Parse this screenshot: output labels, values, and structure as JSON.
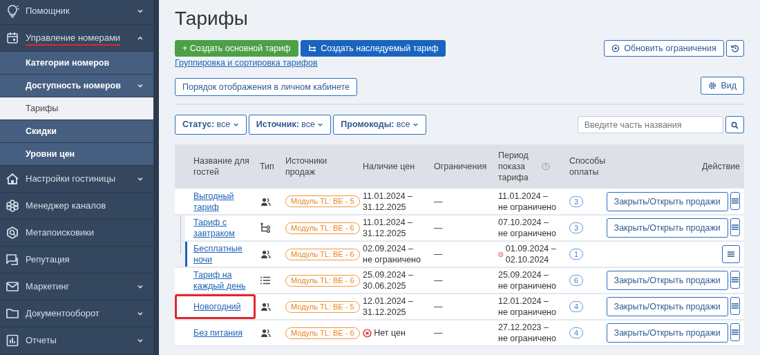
{
  "sidebar": {
    "items": [
      {
        "label": "Помощник",
        "kind": "group",
        "expanded": false,
        "annotated": false
      },
      {
        "label": "Управление номерами",
        "kind": "group",
        "expanded": true,
        "annotated": true,
        "children": [
          {
            "label": "Категории номеров",
            "kind": "link",
            "selected": false
          },
          {
            "label": "Доступность номеров",
            "kind": "group",
            "expanded": false,
            "selected": false
          },
          {
            "label": "Тарифы",
            "kind": "link",
            "selected": true
          },
          {
            "label": "Скидки",
            "kind": "link",
            "selected": false
          },
          {
            "label": "Уровни цен",
            "kind": "link",
            "selected": false
          }
        ]
      },
      {
        "label": "Настройки гостиницы",
        "kind": "group",
        "expanded": false,
        "annotated": false
      },
      {
        "label": "Менеджер каналов",
        "kind": "link",
        "annotated": false
      },
      {
        "label": "Метапоисковики",
        "kind": "link",
        "annotated": false
      },
      {
        "label": "Репутация",
        "kind": "link",
        "annotated": false
      },
      {
        "label": "Маркетинг",
        "kind": "group",
        "expanded": false,
        "annotated": false
      },
      {
        "label": "Документооборот",
        "kind": "group",
        "expanded": false,
        "annotated": false
      },
      {
        "label": "Отчеты",
        "kind": "group",
        "expanded": false,
        "annotated": false
      }
    ]
  },
  "page": {
    "title": "Тарифы",
    "create_main_button": "+ Создать основной тариф",
    "create_inherited_button": "Создать наследуемый тариф",
    "grouping_link": "Группировка и сортировка тарифов",
    "order_button": "Порядок отображения в личном кабинете",
    "update_button": "Обновить ограничения",
    "view_button": "Вид",
    "filters": [
      {
        "label": "Статус:",
        "value": "все"
      },
      {
        "label": "Источник:",
        "value": "все"
      },
      {
        "label": "Промокоды:",
        "value": "все"
      }
    ],
    "search": {
      "placeholder": "Введите часть названия"
    }
  },
  "table": {
    "columns": [
      "Название для гостей",
      "Тип",
      "Источники продаж",
      "Наличие цен",
      "Ограничения",
      "Период показа тарифа",
      "Способы оплаты",
      "Действие"
    ],
    "rows": [
      {
        "name": "Выгодный тариф",
        "kind": "group",
        "source": "Модуль TL: BE - 5",
        "prices": "11.01.2024 – 31.12.2025",
        "prices_error": false,
        "restrictions": "—",
        "period": "11.01.2024 – не ограничено",
        "period_error": false,
        "payment": "3",
        "action": "Закрыть/Открыть продажи",
        "selected": false,
        "annotated": false,
        "children": [
          {
            "name": "Тариф с завтраком",
            "kind": "inherited",
            "source": "Модуль TL: BE - 6",
            "prices": "11.01.2024 – 31.12.2025",
            "prices_error": false,
            "restrictions": "—",
            "period": "07.10.2024 – не ограничено",
            "period_error": false,
            "payment": "3",
            "action": "Закрыть/Открыть продажи",
            "selected": false,
            "annotated": false
          },
          {
            "name": "Бесплатные ночи",
            "kind": "group",
            "source": "Модуль TL: BE - 6",
            "prices": "02.09.2024 – не ограничено",
            "prices_error": false,
            "restrictions": "—",
            "period": "01.09.2024 – 02.10.2024",
            "period_error": true,
            "payment": "1",
            "selected": true,
            "annotated": false
          }
        ]
      },
      {
        "name": "Тариф на каждый день",
        "kind": "daily",
        "source": "Модуль TL: BE - 6",
        "prices": "25.09.2024 – 30.06.2025",
        "prices_error": false,
        "restrictions": "—",
        "period": "25.09.2024 – не ограничено",
        "period_error": false,
        "payment": "6",
        "action": "Закрыть/Открыть продажи",
        "selected": false,
        "annotated": false
      },
      {
        "name": "Новогодний",
        "kind": "group",
        "source": "Модуль TL: BE - 5",
        "prices": "12.01.2024 – 31.12.2025",
        "prices_error": false,
        "restrictions": "—",
        "period": "12.01.2024 – не ограничено",
        "period_error": false,
        "payment": "4",
        "action": "Закрыть/Открыть продажи",
        "selected": false,
        "annotated": true
      },
      {
        "name": "Без питания",
        "kind": "group",
        "source": "Модуль TL: BE - 6",
        "prices": "Нет цен",
        "prices_error": true,
        "restrictions": "—",
        "period": "27.12.2023 – не ограничено",
        "period_error": false,
        "payment": "4",
        "action": "Закрыть/Открыть продажи",
        "selected": false,
        "annotated": false
      }
    ]
  }
}
